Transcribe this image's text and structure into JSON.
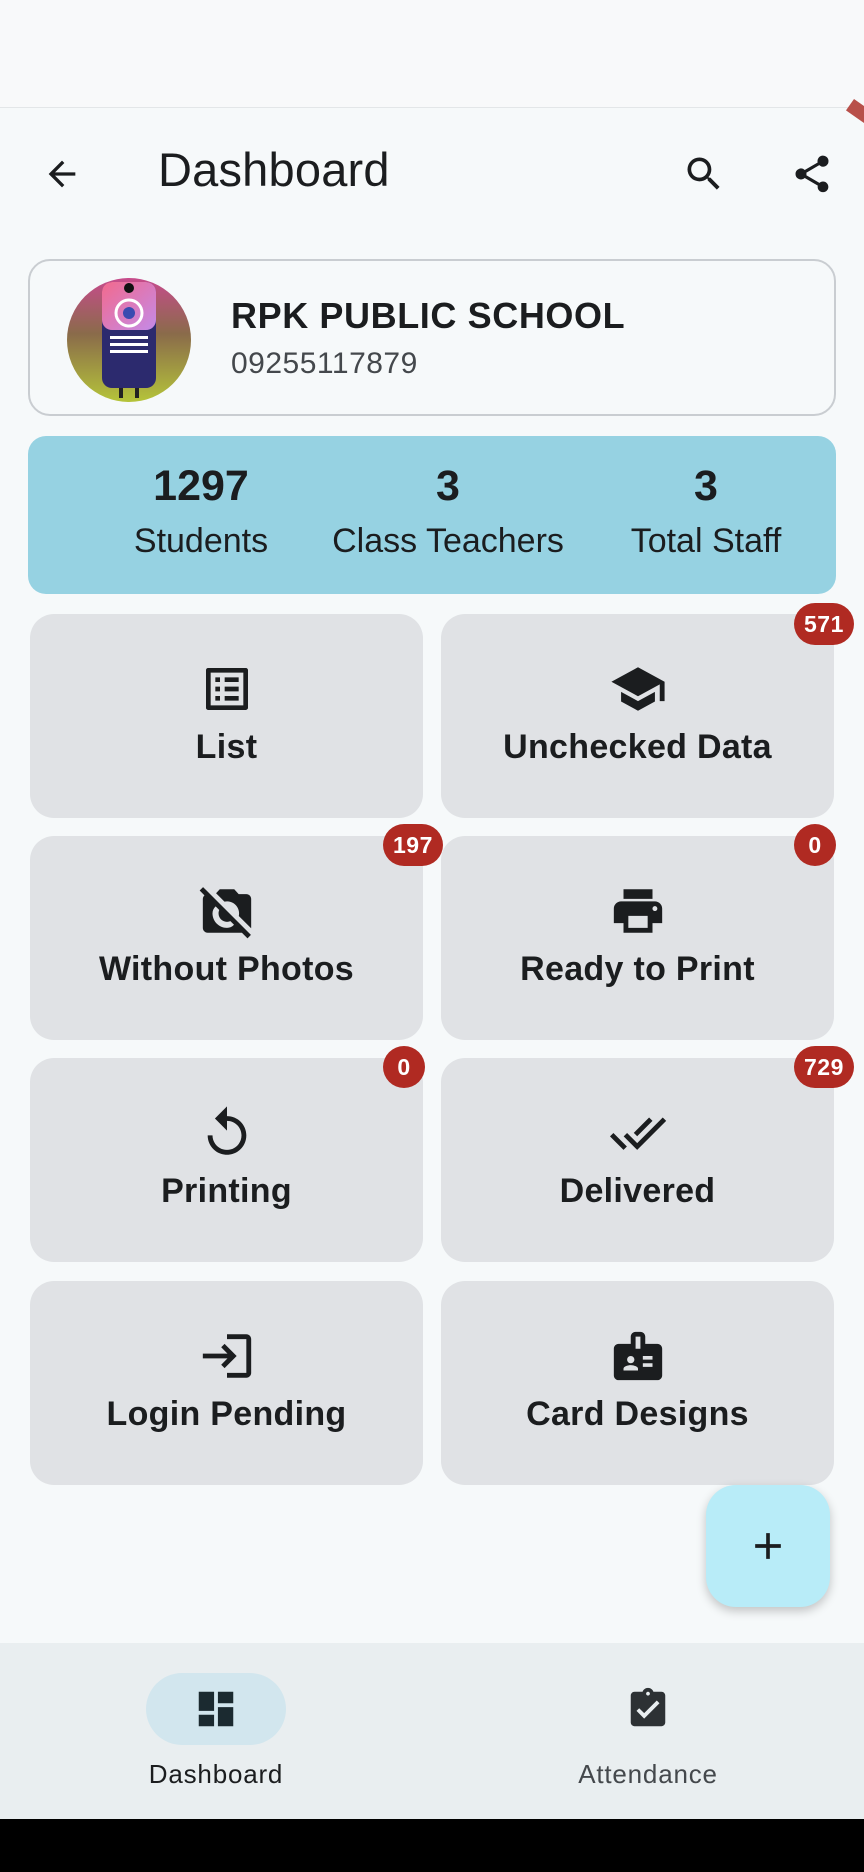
{
  "app_bar": {
    "title": "Dashboard",
    "back_icon": "arrow-back-icon",
    "search_icon": "search-icon",
    "share_icon": "share-icon"
  },
  "school": {
    "name": "RPK PUBLIC SCHOOL",
    "phone": "09255117879",
    "logo_icon": "school-logo"
  },
  "stats": [
    {
      "value": "1297",
      "label": "Students"
    },
    {
      "value": "3",
      "label": "Class Teachers"
    },
    {
      "value": "3",
      "label": "Total Staff"
    }
  ],
  "tiles": [
    {
      "label": "List",
      "icon": "list-icon",
      "badge": null
    },
    {
      "label": "Unchecked Data",
      "icon": "school-cap-icon",
      "badge": "571"
    },
    {
      "label": "Without Photos",
      "icon": "no-photography-icon",
      "badge": "197"
    },
    {
      "label": "Ready to Print",
      "icon": "printer-icon",
      "badge": "0"
    },
    {
      "label": "Printing",
      "icon": "refresh-icon",
      "badge": "0"
    },
    {
      "label": "Delivered",
      "icon": "done-all-icon",
      "badge": "729"
    },
    {
      "label": "Login Pending",
      "icon": "login-icon",
      "badge": null
    },
    {
      "label": "Card Designs",
      "icon": "badge-icon",
      "badge": null
    }
  ],
  "fab": {
    "icon": "plus-icon"
  },
  "bottom_nav": [
    {
      "label": "Dashboard",
      "icon": "dashboard-icon",
      "active": true
    },
    {
      "label": "Attendance",
      "icon": "assignment-check-icon",
      "active": false
    }
  ],
  "colors": {
    "stats_bg": "#96d2e2",
    "tile_bg": "#e0e2e5",
    "badge_bg": "#b02a22",
    "fab_bg": "#b8ecf8",
    "nav_active": "#d2e6ee"
  }
}
